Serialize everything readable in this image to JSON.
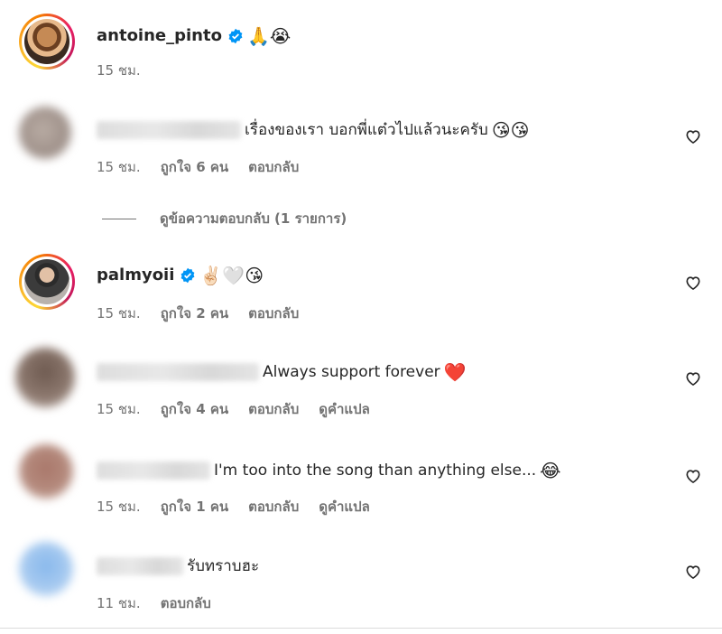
{
  "comments": [
    {
      "username": "antoine_pinto",
      "verified": true,
      "text": "",
      "emoji": "🙏😭",
      "time": "15 ชม.",
      "likes": "",
      "reply": ""
    },
    {
      "username": "",
      "verified": false,
      "text": "เรื่องของเรา บอกพี่แต๋วไปแล้วนะครับ",
      "emoji": "😘😘",
      "time": "15 ชม.",
      "likes": "ถูกใจ 6 คน",
      "reply": "ตอบกลับ"
    },
    {
      "username": "palmyoii",
      "verified": true,
      "text": "",
      "emoji": "✌🏻🤍😘",
      "time": "15 ชม.",
      "likes": "ถูกใจ 2 คน",
      "reply": "ตอบกลับ"
    },
    {
      "username": "",
      "verified": false,
      "text": "Always support forever",
      "emoji": "❤️",
      "time": "15 ชม.",
      "likes": "ถูกใจ 4 คน",
      "reply": "ตอบกลับ",
      "translate": "ดูคำแปล"
    },
    {
      "username": "",
      "verified": false,
      "text": "I'm too into the song than anything else...",
      "emoji": "😂",
      "time": "15 ชม.",
      "likes": "ถูกใจ 1 คน",
      "reply": "ตอบกลับ",
      "translate": "ดูคำแปล"
    },
    {
      "username": "",
      "verified": false,
      "text": "รับทราบฮะ",
      "emoji": "",
      "time": "11 ชม.",
      "reply": "ตอบกลับ"
    }
  ],
  "view_replies_label": "ดูข้อความตอบกลับ (1 รายการ)",
  "icons": {
    "verified": "verified-badge-icon",
    "like": "heart-outline-icon"
  },
  "colors": {
    "verified": "#0095f6",
    "meta": "#737373",
    "text": "#262626"
  }
}
